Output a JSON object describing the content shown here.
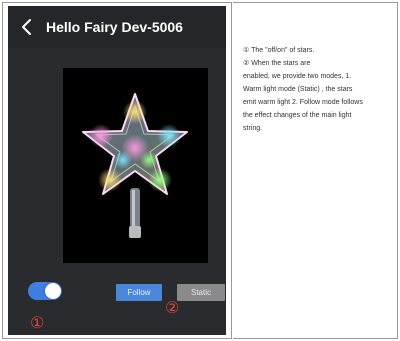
{
  "app": {
    "title": "Hello Fairy Dev-5006",
    "back_icon": "chevron-left-icon"
  },
  "controls": {
    "power_toggle": {
      "state": "on",
      "color": "#3f7fe0"
    },
    "follow_label": "Follow",
    "static_label": "Static",
    "follow_color": "#4a86d9",
    "static_color": "#8a8a8a"
  },
  "markers": {
    "one": "①",
    "two": "②",
    "color": "#e04538"
  },
  "notes": {
    "lines": [
      "① The \"off/on\"  of stars.",
      "② When the stars are",
      "enabled, we provide two modes, 1.",
      "Warm light mode (Static) , the stars",
      "emit  warm light 2. Follow mode follows",
      "the effect changes of the main light",
      "string."
    ]
  }
}
